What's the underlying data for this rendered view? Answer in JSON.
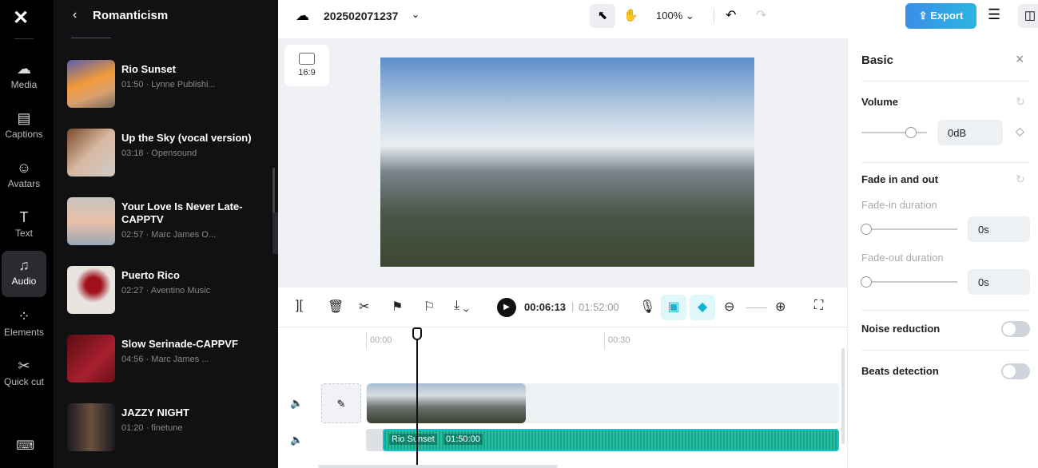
{
  "rail": {
    "items": [
      {
        "label": "Media",
        "icon": "cloud-upload-icon"
      },
      {
        "label": "Captions",
        "icon": "captions-icon"
      },
      {
        "label": "Avatars",
        "icon": "avatar-icon"
      },
      {
        "label": "Text",
        "icon": "text-icon"
      },
      {
        "label": "Audio",
        "icon": "music-icon",
        "active": true
      },
      {
        "label": "Elements",
        "icon": "elements-icon"
      },
      {
        "label": "Quick cut",
        "icon": "quick-cut-icon"
      }
    ]
  },
  "panel": {
    "title": "Romanticism",
    "tracks": [
      {
        "name": "Rio Sunset",
        "meta": "01:50 · Lynne Publishi..."
      },
      {
        "name": "Up the Sky (vocal version)",
        "meta": "03:18 · Opensound"
      },
      {
        "name": "Your Love Is Never Late-CAPPTV",
        "meta": "02:57 · Marc James O..."
      },
      {
        "name": "Puerto Rico",
        "meta": "02:27 · Aventino Music"
      },
      {
        "name": "Slow Serinade-CAPPVF",
        "meta": "04:56 · Marc James ..."
      },
      {
        "name": "JAZZY NIGHT",
        "meta": "01:20 · finetune"
      }
    ]
  },
  "topbar": {
    "project": "202502071237",
    "zoom": "100%",
    "export": "Export",
    "accent": "#3a8ee6"
  },
  "preview": {
    "aspect": "16:9"
  },
  "toolbar": {
    "current": "00:06:13",
    "total": "01:52:00"
  },
  "timeline": {
    "ticks": [
      "00:00",
      "00:30"
    ],
    "audio_clip": "Rio Sunset",
    "audio_duration": "01:50:00"
  },
  "right": {
    "title": "Basic",
    "volume_label": "Volume",
    "volume": "0dB",
    "fade_label": "Fade in and out",
    "fadein_label": "Fade-in duration",
    "fadein": "0s",
    "fadeout_label": "Fade-out duration",
    "fadeout": "0s",
    "noise": "Noise reduction",
    "beats": "Beats detection"
  }
}
